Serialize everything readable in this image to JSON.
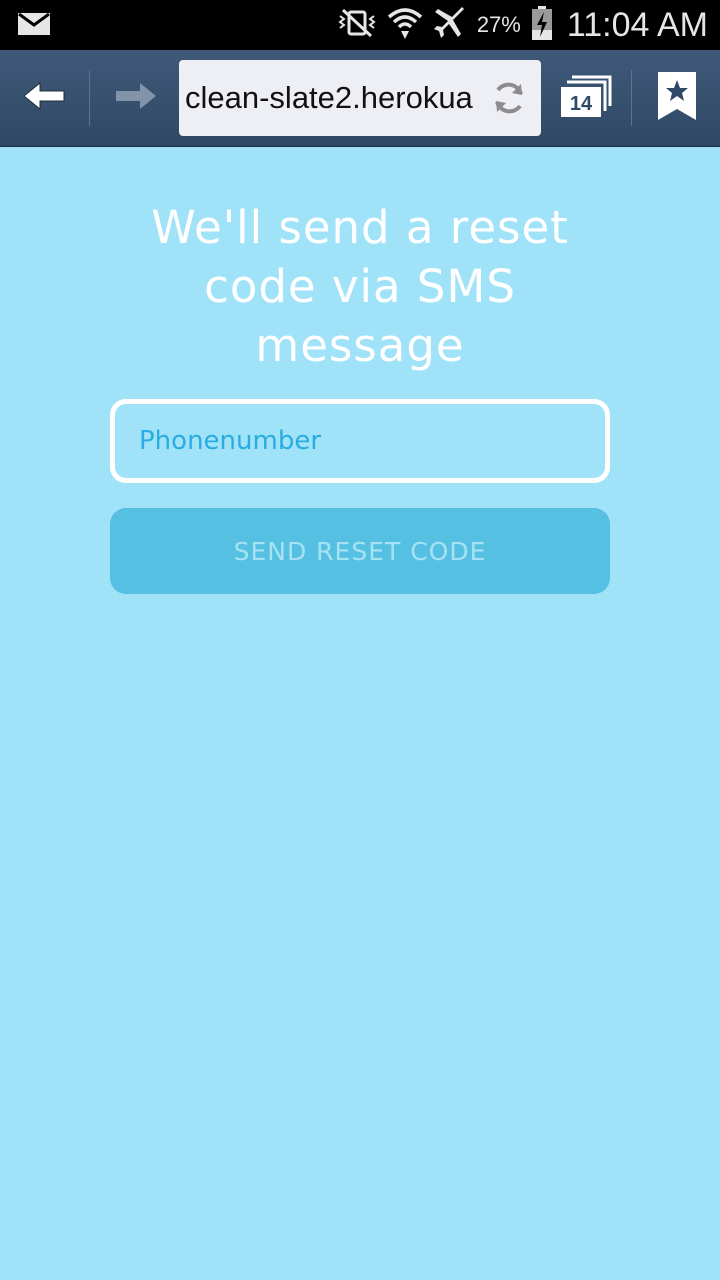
{
  "status_bar": {
    "battery_percent": "27%",
    "time": "11:04 AM"
  },
  "browser": {
    "url": "clean-slate2.herokua",
    "tab_count": "14",
    "icons": [
      "back-arrow-icon",
      "forward-arrow-icon",
      "reload-icon",
      "tabs-icon",
      "bookmark-icon"
    ]
  },
  "page": {
    "headline": "We'll send a reset code via SMS message",
    "phone_placeholder": "Phonenumber",
    "send_button_label": "SEND RESET CODE"
  },
  "colors": {
    "background": "#a0e3f9",
    "toolbar": "#2e4866",
    "button": "#55c0e1",
    "placeholder": "#2aace0"
  }
}
